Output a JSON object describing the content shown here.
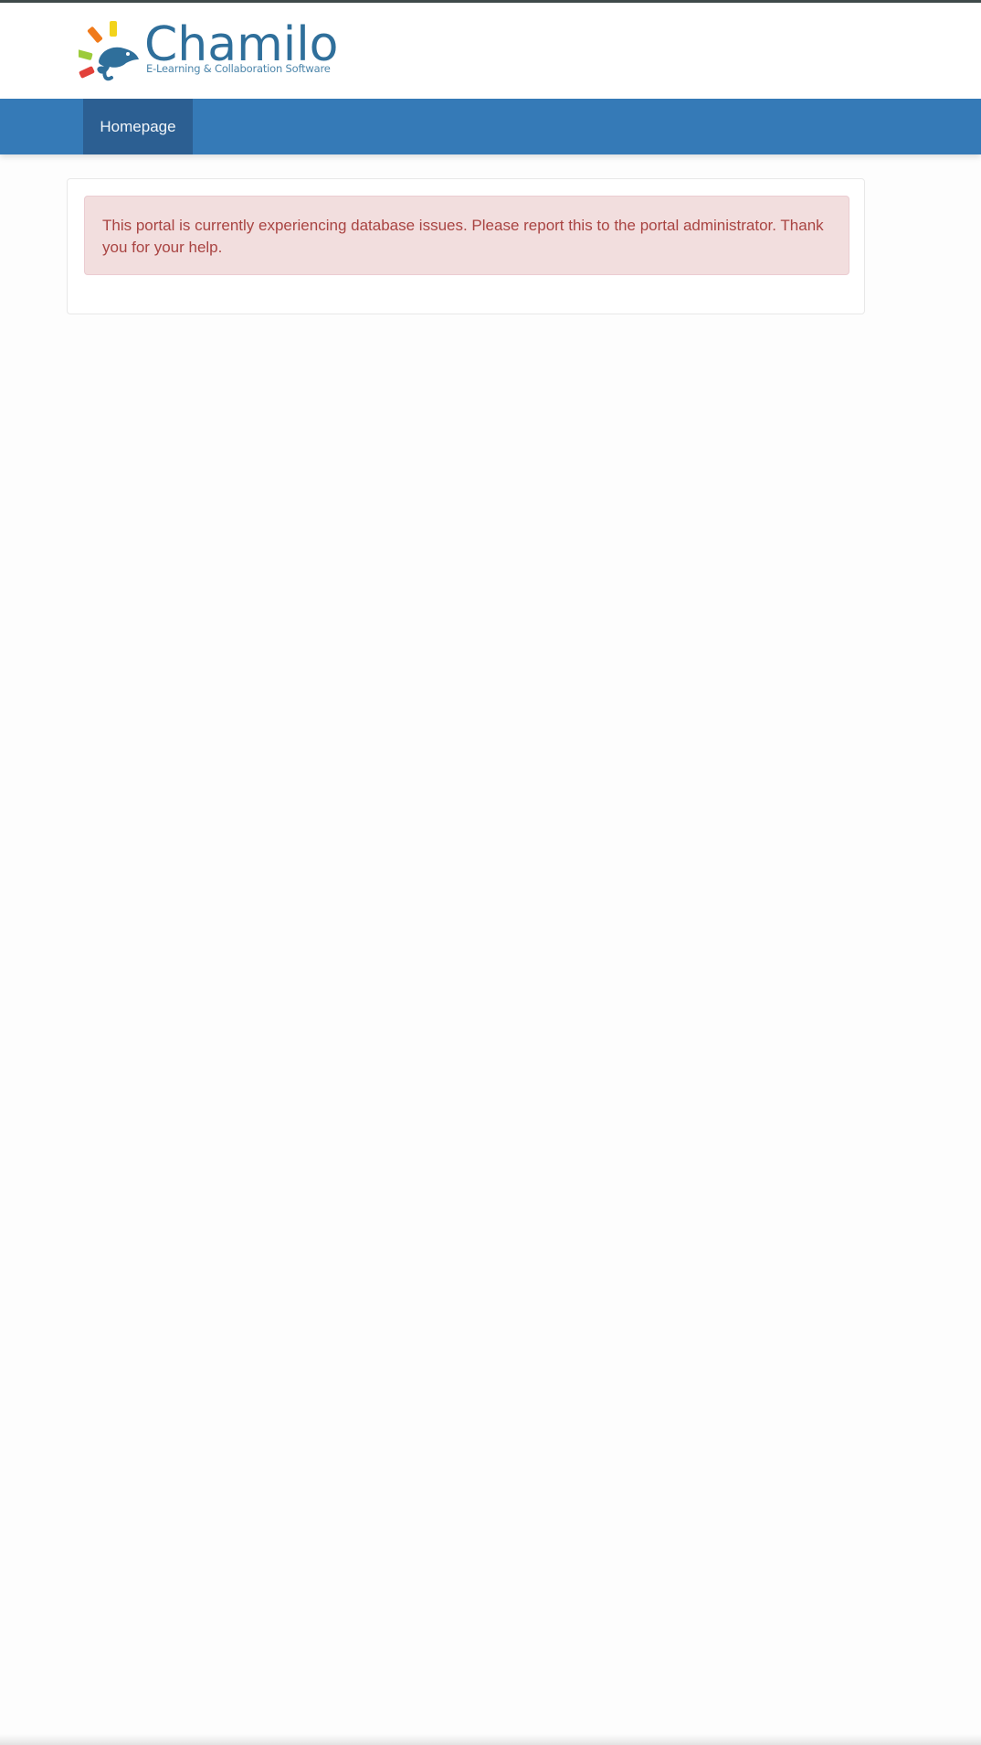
{
  "branding": {
    "logo_word": "Chamilo",
    "logo_tagline": "E-Learning & Collaboration Software",
    "logo_icon": "chameleon-sun-icon"
  },
  "navbar": {
    "items": [
      {
        "label": "Homepage",
        "active": true
      }
    ]
  },
  "alert": {
    "type": "error",
    "message": "This portal is currently experiencing database issues. Please report this to the portal administrator. Thank you for your help."
  },
  "colors": {
    "top_strip": "#3f4a4a",
    "navbar": "#357ab7",
    "nav_active": "#2c5f92",
    "brand_blue": "#2f6f9b",
    "alert_bg": "#f2dede",
    "alert_border": "#ebccd1",
    "alert_text": "#a94442"
  }
}
